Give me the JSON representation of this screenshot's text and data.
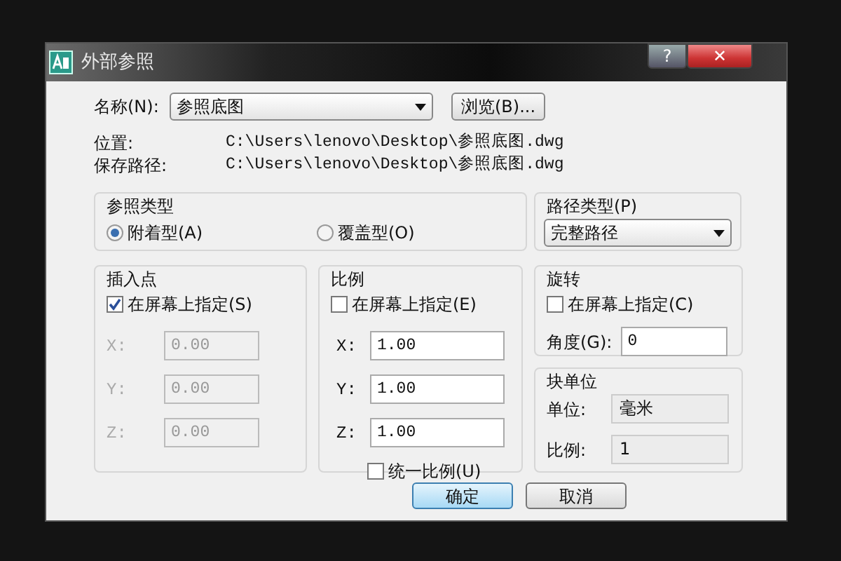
{
  "window": {
    "title": "外部参照"
  },
  "title_buttons": [
    {
      "label": "?",
      "kind": "help"
    },
    {
      "label": "✕",
      "kind": "close"
    }
  ],
  "name_field": {
    "label": "名称(N):",
    "value": "参照底图"
  },
  "browse_button": "浏览(B)...",
  "info": [
    {
      "label": "位置:",
      "value": "C:\\Users\\lenovo\\Desktop\\参照底图.dwg"
    },
    {
      "label": "保存路径:",
      "value": "C:\\Users\\lenovo\\Desktop\\参照底图.dwg"
    }
  ],
  "reference_type": {
    "title": "参照类型",
    "options": [
      {
        "label": "附着型(A)",
        "selected": true
      },
      {
        "label": "覆盖型(O)",
        "selected": false
      }
    ]
  },
  "path_type": {
    "title": "路径类型(P)",
    "value": "完整路径"
  },
  "insertion_point": {
    "title": "插入点",
    "specify": {
      "label": "在屏幕上指定(S)",
      "checked": true
    },
    "fields": [
      {
        "label": "X:",
        "value": "0.00",
        "disabled": true
      },
      {
        "label": "Y:",
        "value": "0.00",
        "disabled": true
      },
      {
        "label": "Z:",
        "value": "0.00",
        "disabled": true
      }
    ]
  },
  "scale": {
    "title": "比例",
    "specify": {
      "label": "在屏幕上指定(E)",
      "checked": false
    },
    "fields": [
      {
        "label": "X:",
        "value": "1.00",
        "disabled": false
      },
      {
        "label": "Y:",
        "value": "1.00",
        "disabled": false
      },
      {
        "label": "Z:",
        "value": "1.00",
        "disabled": false
      }
    ],
    "uniform": {
      "label": "统一比例(U)",
      "checked": false
    }
  },
  "rotation": {
    "title": "旋转",
    "specify": {
      "label": "在屏幕上指定(C)",
      "checked": false
    },
    "angle": {
      "label": "角度(G):",
      "value": "0"
    }
  },
  "block_unit": {
    "title": "块单位",
    "rows": [
      {
        "label": "单位:",
        "value": "毫米"
      },
      {
        "label": "比例:",
        "value": "1"
      }
    ]
  },
  "buttons": [
    {
      "label": "确定",
      "default": true
    },
    {
      "label": "取消",
      "default": false
    }
  ]
}
